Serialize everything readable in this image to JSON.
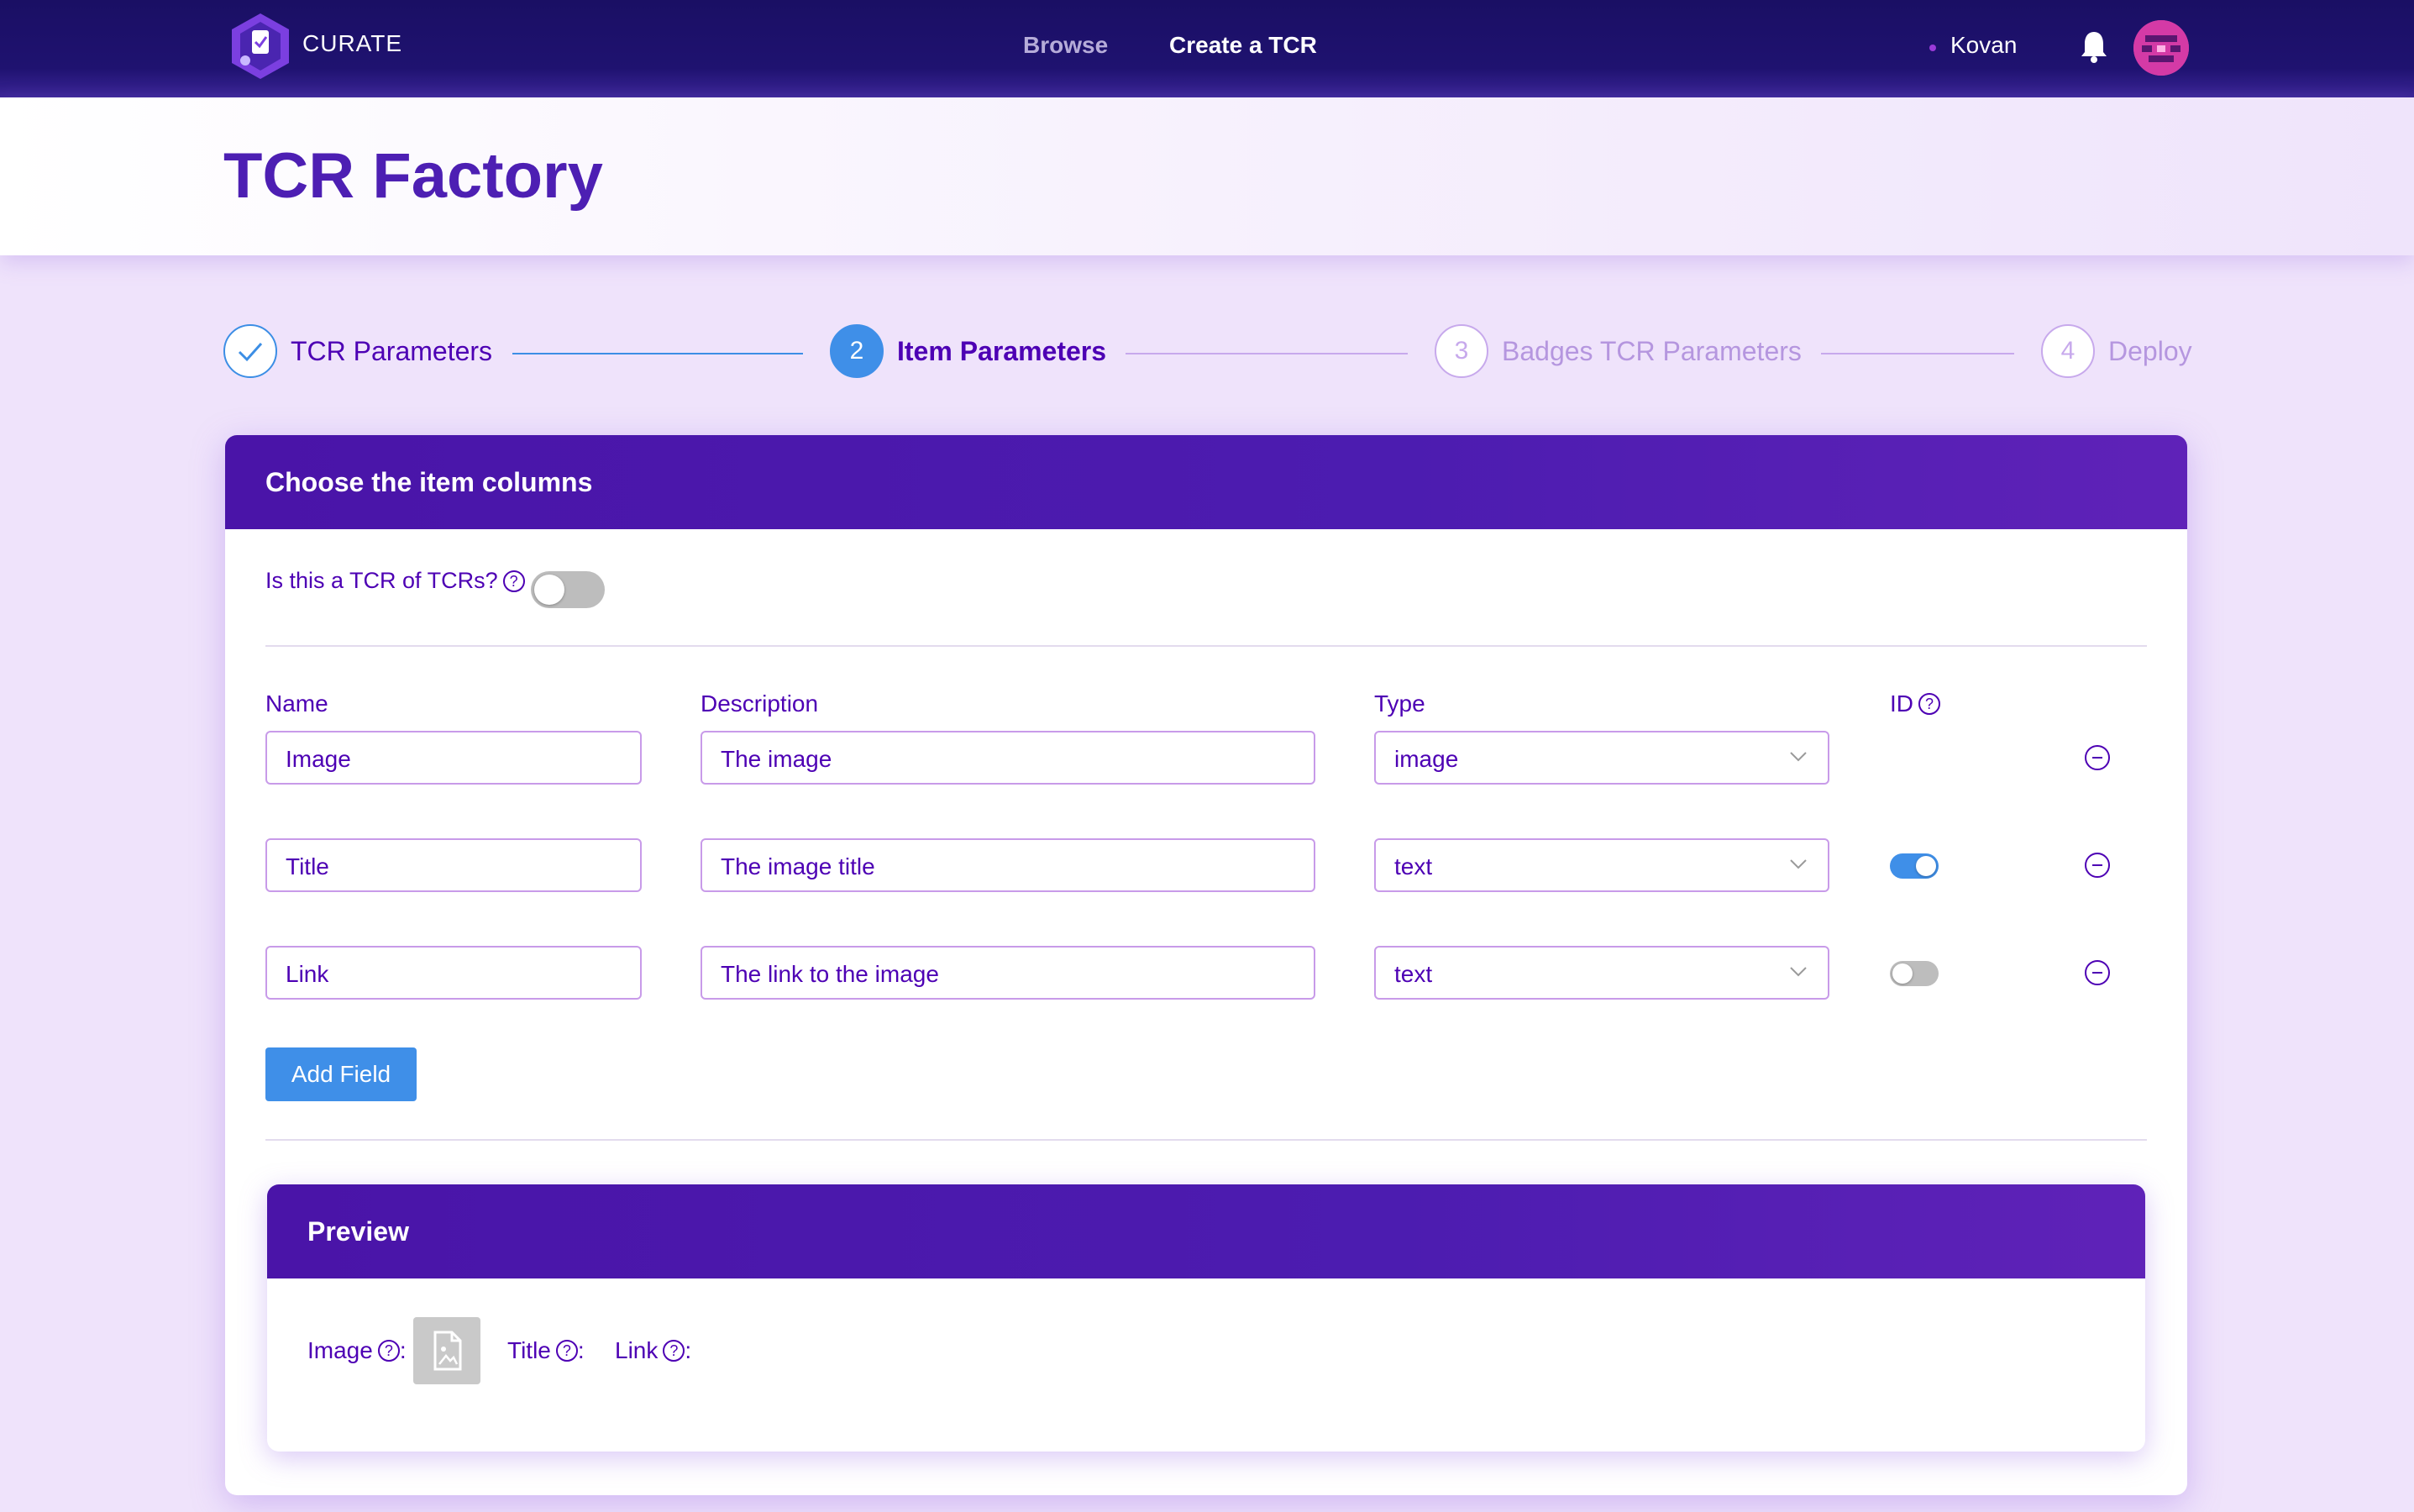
{
  "nav": {
    "logo_text": "CURATE",
    "browse": "Browse",
    "create": "Create a TCR",
    "network": "Kovan"
  },
  "page": {
    "title": "TCR Factory"
  },
  "steps": [
    {
      "number": "1",
      "label": "TCR Parameters",
      "state": "done"
    },
    {
      "number": "2",
      "label": "Item Parameters",
      "state": "active"
    },
    {
      "number": "3",
      "label": "Badges TCR Parameters",
      "state": "pending"
    },
    {
      "number": "4",
      "label": "Deploy",
      "state": "pending"
    }
  ],
  "card": {
    "title": "Choose the item columns",
    "tcr_of_tcrs_label": "Is this a TCR of TCRs?",
    "tcr_of_tcrs_on": false,
    "help_glyph": "?",
    "columns": {
      "name": "Name",
      "description": "Description",
      "type": "Type",
      "id": "ID"
    },
    "rows": [
      {
        "name": "Image",
        "description": "The image",
        "type": "image",
        "id_toggle": null
      },
      {
        "name": "Title",
        "description": "The image title",
        "type": "text",
        "id_toggle": true
      },
      {
        "name": "Link",
        "description": "The link to the image",
        "type": "text",
        "id_toggle": false
      }
    ],
    "add_field": "Add Field"
  },
  "preview": {
    "title": "Preview",
    "image_label": "Image",
    "title_label": "Title",
    "link_label": "Link",
    "colon": ":"
  },
  "colors": {
    "nav_bg": "#1a0f64",
    "accent_purple": "#4d00b4",
    "accent_blue": "#3f8fe8",
    "card_head": "#4a14a8"
  }
}
